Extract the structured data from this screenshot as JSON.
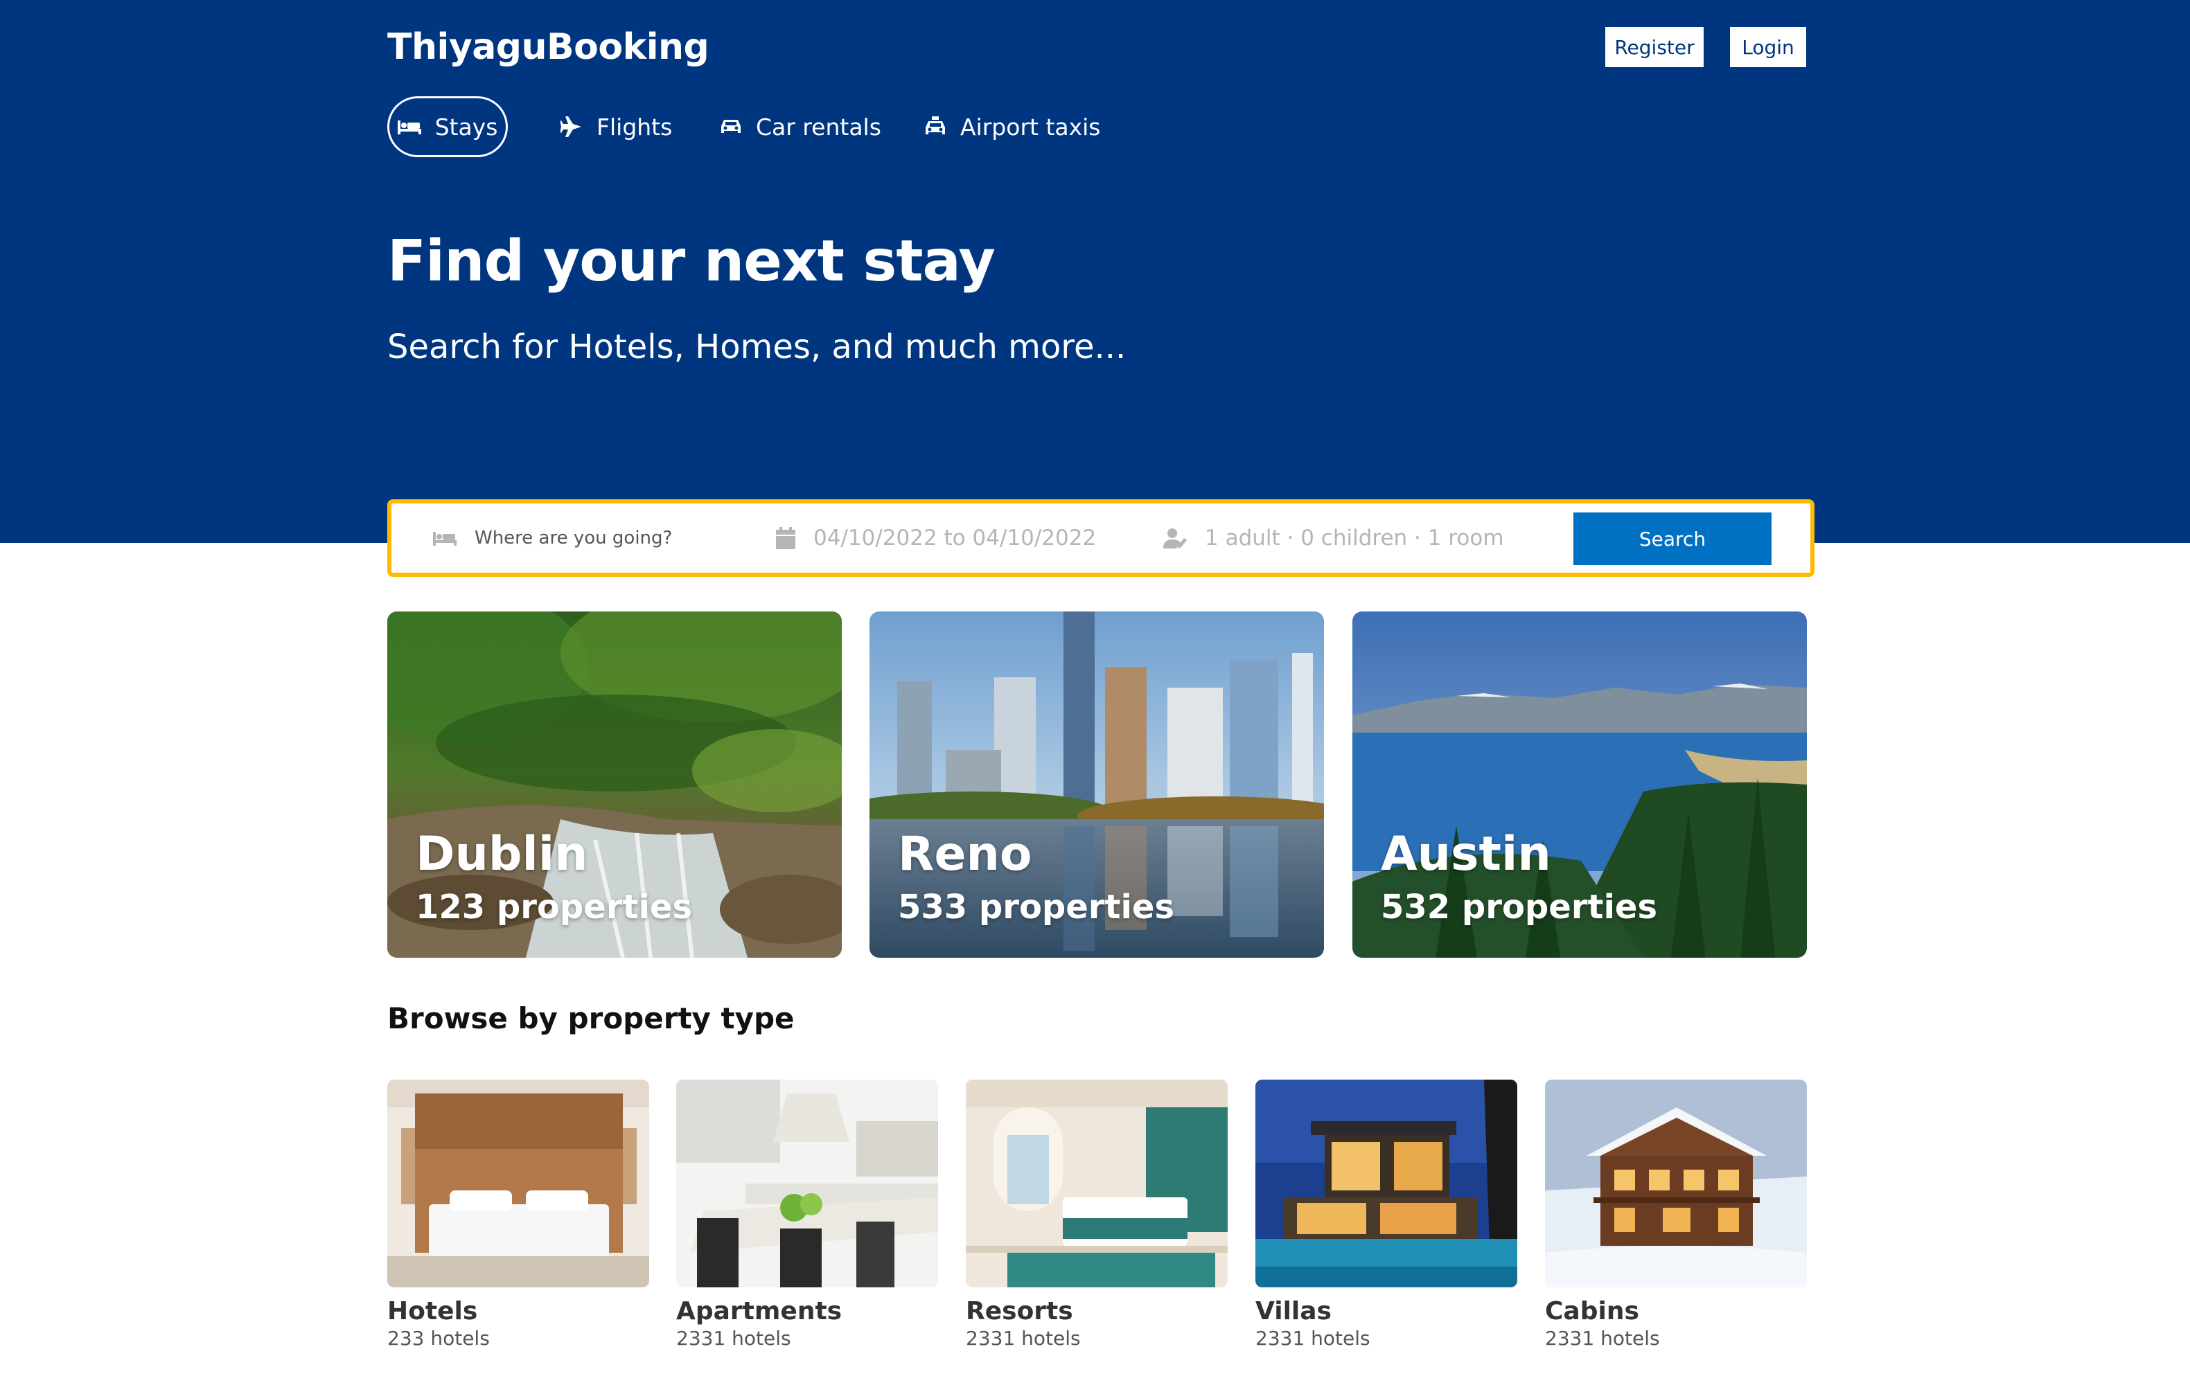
{
  "brand": {
    "name": "ThiyaguBooking",
    "primary_color": "#003580",
    "accent_color": "#febb02",
    "button_color": "#0071c2"
  },
  "auth": {
    "register_label": "Register",
    "login_label": "Login"
  },
  "nav": {
    "items": [
      {
        "label": "Stays",
        "icon": "bed-icon",
        "active": true
      },
      {
        "label": "Flights",
        "icon": "plane-icon",
        "active": false
      },
      {
        "label": "Car rentals",
        "icon": "car-icon",
        "active": false
      },
      {
        "label": "Airport taxis",
        "icon": "taxi-icon",
        "active": false
      }
    ]
  },
  "hero": {
    "title": "Find your next stay",
    "subtitle": "Search for Hotels, Homes, and much more..."
  },
  "search": {
    "destination_placeholder": "Where are you going?",
    "dates": "04/10/2022 to 04/10/2022",
    "guests": "1 adult · 0 children · 1 room",
    "button_label": "Search"
  },
  "featured": [
    {
      "city": "Dublin",
      "properties": "123 properties"
    },
    {
      "city": "Reno",
      "properties": "533 properties"
    },
    {
      "city": "Austin",
      "properties": "532 properties"
    }
  ],
  "property_types": {
    "title": "Browse by property type",
    "items": [
      {
        "name": "Hotels",
        "count": "233 hotels"
      },
      {
        "name": "Apartments",
        "count": "2331 hotels"
      },
      {
        "name": "Resorts",
        "count": "2331 hotels"
      },
      {
        "name": "Villas",
        "count": "2331 hotels"
      },
      {
        "name": "Cabins",
        "count": "2331 hotels"
      }
    ]
  }
}
